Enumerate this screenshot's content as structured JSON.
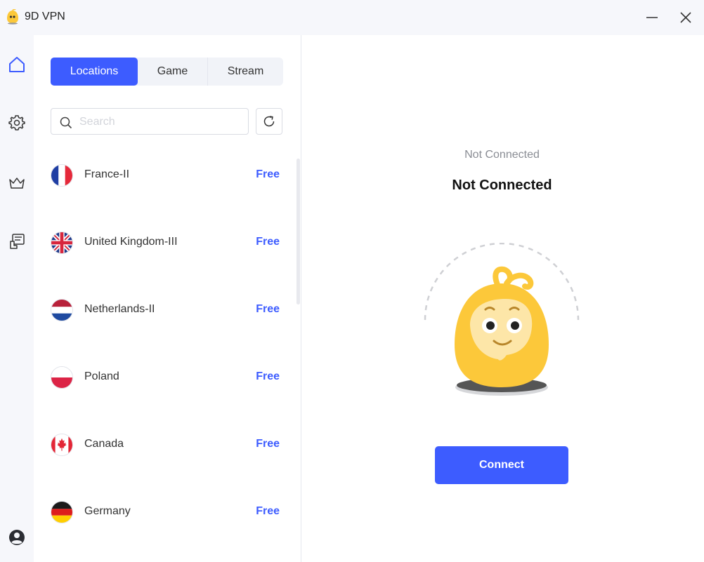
{
  "app": {
    "title": "9D VPN"
  },
  "window_controls": {
    "minimize_icon": "minimize-icon",
    "close_icon": "close-icon"
  },
  "nav": {
    "items": [
      {
        "name": "home",
        "icon": "home-icon",
        "active": true
      },
      {
        "name": "settings",
        "icon": "gear-icon"
      },
      {
        "name": "premium",
        "icon": "crown-icon"
      },
      {
        "name": "feedback",
        "icon": "feedback-icon"
      },
      {
        "name": "account",
        "icon": "user-icon"
      }
    ],
    "active_color": "#3d5cff"
  },
  "tabs": [
    {
      "label": "Locations",
      "active": true
    },
    {
      "label": "Game",
      "active": false
    },
    {
      "label": "Stream",
      "active": false
    }
  ],
  "search": {
    "placeholder": "Search",
    "value": ""
  },
  "servers": [
    {
      "name": "France-II",
      "tier": "Free",
      "flag": "france-flag-icon"
    },
    {
      "name": "United Kingdom-III",
      "tier": "Free",
      "flag": "uk-flag-icon"
    },
    {
      "name": "Netherlands-II",
      "tier": "Free",
      "flag": "netherlands-flag-icon"
    },
    {
      "name": "Poland",
      "tier": "Free",
      "flag": "poland-flag-icon"
    },
    {
      "name": "Canada",
      "tier": "Free",
      "flag": "canada-flag-icon"
    },
    {
      "name": "Germany",
      "tier": "Free",
      "flag": "germany-flag-icon"
    }
  ],
  "status": {
    "subtitle": "Not Connected",
    "title": "Not Connected"
  },
  "connect": {
    "label": "Connect"
  },
  "colors": {
    "accent": "#3d5cff",
    "mascot": "#fcc83a"
  }
}
